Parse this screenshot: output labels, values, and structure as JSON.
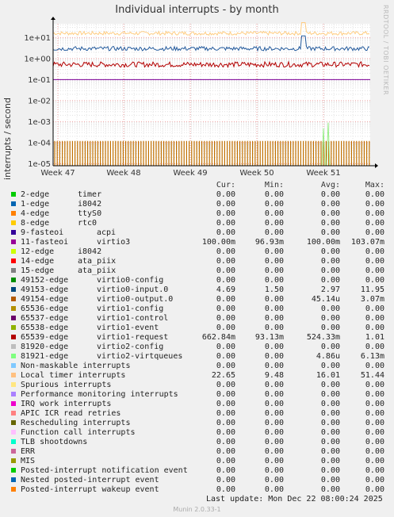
{
  "title": "Individual interrupts - by month",
  "watermark": "RRDTOOL / TOBI OETIKER",
  "ylabel": "interrupts / second",
  "chart_data": {
    "type": "line",
    "yscale": "log",
    "ylim": [
      8e-06,
      45
    ],
    "y_ticks": [
      "1e-05",
      "1e-04",
      "1e-03",
      "1e-02",
      "1e-01",
      "1e+00",
      "1e+01"
    ],
    "x_ticks": [
      "Week 47",
      "Week 48",
      "Week 49",
      "Week 50",
      "Week 51"
    ],
    "grid": true,
    "series": [
      {
        "name": "Local timer interrupts",
        "color": "#ffcc80",
        "min": 9.48,
        "max": 51.44,
        "typical": 16.01
      },
      {
        "name": "65539-edge virtio1-request",
        "color": "#235a9c",
        "min": 0.0931,
        "max": 1.01,
        "typical": 0.5243
      },
      {
        "name": "49153-edge virtio0-input.0",
        "color": "#235a9c",
        "min": 1.5,
        "max": 11.95,
        "typical": 2.97
      },
      {
        "name": "11-fasteoi virtio3",
        "color": "#7a0099",
        "min": 0.0969,
        "max": 0.1037,
        "typical": 0.1
      },
      {
        "name": "49154-edge virtio0-output.0",
        "color": "#c07000",
        "min": 0.0,
        "max": 0.00307,
        "typical": 4.51e-05
      },
      {
        "name": "81921-edge virtio2-virtqueues",
        "color": "#99ee88",
        "min": 0.0,
        "max": 0.00613,
        "typical": 4.86e-06
      }
    ]
  },
  "legend": {
    "headers": [
      "Cur:",
      "Min:",
      "Avg:",
      "Max:"
    ],
    "rows": [
      {
        "name": "2-edge",
        "label": "timer",
        "color": "#00cc00",
        "cur": "0.00",
        "min": "0.00",
        "avg": "0.00",
        "max": "0.00"
      },
      {
        "name": "1-edge",
        "label": "i8042",
        "color": "#0066b3",
        "cur": "0.00",
        "min": "0.00",
        "avg": "0.00",
        "max": "0.00"
      },
      {
        "name": "4-edge",
        "label": "ttyS0",
        "color": "#ff8000",
        "cur": "0.00",
        "min": "0.00",
        "avg": "0.00",
        "max": "0.00"
      },
      {
        "name": "8-edge",
        "label": "rtc0",
        "color": "#ffcc00",
        "cur": "0.00",
        "min": "0.00",
        "avg": "0.00",
        "max": "0.00"
      },
      {
        "name": "9-fasteoi",
        "label": "acpi",
        "color": "#330099",
        "cur": "0.00",
        "min": "0.00",
        "avg": "0.00",
        "max": "0.00"
      },
      {
        "name": "11-fasteoi",
        "label": "virtio3",
        "color": "#990099",
        "cur": "100.00m",
        "min": "96.93m",
        "avg": "100.00m",
        "max": "103.07m"
      },
      {
        "name": "12-edge",
        "label": "i8042",
        "color": "#ccff00",
        "cur": "0.00",
        "min": "0.00",
        "avg": "0.00",
        "max": "0.00"
      },
      {
        "name": "14-edge",
        "label": "ata_piix",
        "color": "#ff0000",
        "cur": "0.00",
        "min": "0.00",
        "avg": "0.00",
        "max": "0.00"
      },
      {
        "name": "15-edge",
        "label": "ata_piix",
        "color": "#808080",
        "cur": "0.00",
        "min": "0.00",
        "avg": "0.00",
        "max": "0.00"
      },
      {
        "name": "49152-edge",
        "label": "virtio0-config",
        "color": "#008f00",
        "cur": "0.00",
        "min": "0.00",
        "avg": "0.00",
        "max": "0.00"
      },
      {
        "name": "49153-edge",
        "label": "virtio0-input.0",
        "color": "#00487d",
        "cur": "4.69",
        "min": "1.50",
        "avg": "2.97",
        "max": "11.95"
      },
      {
        "name": "49154-edge",
        "label": "virtio0-output.0",
        "color": "#b35a00",
        "cur": "0.00",
        "min": "0.00",
        "avg": "45.14u",
        "max": "3.07m"
      },
      {
        "name": "65536-edge",
        "label": "virtio1-config",
        "color": "#b38f00",
        "cur": "0.00",
        "min": "0.00",
        "avg": "0.00",
        "max": "0.00"
      },
      {
        "name": "65537-edge",
        "label": "virtio1-control",
        "color": "#6b006b",
        "cur": "0.00",
        "min": "0.00",
        "avg": "0.00",
        "max": "0.00"
      },
      {
        "name": "65538-edge",
        "label": "virtio1-event",
        "color": "#8fb300",
        "cur": "0.00",
        "min": "0.00",
        "avg": "0.00",
        "max": "0.00"
      },
      {
        "name": "65539-edge",
        "label": "virtio1-request",
        "color": "#b30000",
        "cur": "662.84m",
        "min": "93.13m",
        "avg": "524.33m",
        "max": "1.01"
      },
      {
        "name": "81920-edge",
        "label": "virtio2-config",
        "color": "#bebebe",
        "cur": "0.00",
        "min": "0.00",
        "avg": "0.00",
        "max": "0.00"
      },
      {
        "name": "81921-edge",
        "label": "virtio2-virtqueues",
        "color": "#80ff80",
        "cur": "0.00",
        "min": "0.00",
        "avg": "4.86u",
        "max": "6.13m"
      },
      {
        "name": "Non-maskable interrupts",
        "label": "",
        "color": "#80c9ff",
        "cur": "0.00",
        "min": "0.00",
        "avg": "0.00",
        "max": "0.00"
      },
      {
        "name": "Local timer interrupts",
        "label": "",
        "color": "#ffc080",
        "cur": "22.65",
        "min": "9.48",
        "avg": "16.01",
        "max": "51.44"
      },
      {
        "name": "Spurious interrupts",
        "label": "",
        "color": "#ffe680",
        "cur": "0.00",
        "min": "0.00",
        "avg": "0.00",
        "max": "0.00"
      },
      {
        "name": "Performance monitoring interrupts",
        "label": "",
        "color": "#aa80ff",
        "cur": "0.00",
        "min": "0.00",
        "avg": "0.00",
        "max": "0.00"
      },
      {
        "name": "IRQ work interrupts",
        "label": "",
        "color": "#ee00cc",
        "cur": "0.00",
        "min": "0.00",
        "avg": "0.00",
        "max": "0.00"
      },
      {
        "name": "APIC ICR read retries",
        "label": "",
        "color": "#ff8080",
        "cur": "0.00",
        "min": "0.00",
        "avg": "0.00",
        "max": "0.00"
      },
      {
        "name": "Rescheduling interrupts",
        "label": "",
        "color": "#666600",
        "cur": "0.00",
        "min": "0.00",
        "avg": "0.00",
        "max": "0.00"
      },
      {
        "name": "Function call interrupts",
        "label": "",
        "color": "#ffbfff",
        "cur": "0.00",
        "min": "0.00",
        "avg": "0.00",
        "max": "0.00"
      },
      {
        "name": "TLB shootdowns",
        "label": "",
        "color": "#00ffcc",
        "cur": "0.00",
        "min": "0.00",
        "avg": "0.00",
        "max": "0.00"
      },
      {
        "name": "ERR",
        "label": "",
        "color": "#cc6699",
        "cur": "0.00",
        "min": "0.00",
        "avg": "0.00",
        "max": "0.00"
      },
      {
        "name": "MIS",
        "label": "",
        "color": "#999900",
        "cur": "0.00",
        "min": "0.00",
        "avg": "0.00",
        "max": "0.00"
      },
      {
        "name": "Posted-interrupt notification event",
        "label": "",
        "color": "#00cc00",
        "cur": "0.00",
        "min": "0.00",
        "avg": "0.00",
        "max": "0.00"
      },
      {
        "name": "Nested posted-interrupt event",
        "label": "",
        "color": "#0066b3",
        "cur": "0.00",
        "min": "0.00",
        "avg": "0.00",
        "max": "0.00"
      },
      {
        "name": "Posted-interrupt wakeup event",
        "label": "",
        "color": "#ff8000",
        "cur": "0.00",
        "min": "0.00",
        "avg": "0.00",
        "max": "0.00"
      }
    ]
  },
  "last_update": "Last update:  Mon Dec 22 08:00:24 2025",
  "version": "Munin 2.0.33-1"
}
